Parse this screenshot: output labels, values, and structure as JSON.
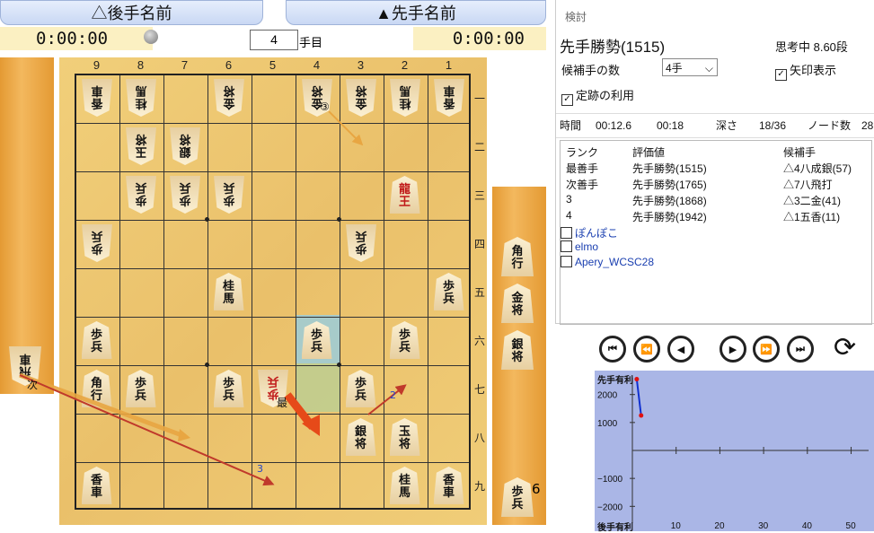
{
  "header": {
    "gote_name": "△後手名前",
    "sente_name": "▲先手名前",
    "gote_time": "0:00:00",
    "sente_time": "0:00:00",
    "move_number": "4",
    "move_unit": "手目"
  },
  "board": {
    "col_labels": [
      "9",
      "8",
      "7",
      "6",
      "5",
      "4",
      "3",
      "2",
      "1"
    ],
    "row_labels": [
      "一",
      "二",
      "三",
      "四",
      "五",
      "六",
      "七",
      "八",
      "九"
    ],
    "pieces": [
      {
        "c": 0,
        "r": 0,
        "t": [
          "香",
          "車"
        ],
        "g": true
      },
      {
        "c": 1,
        "r": 0,
        "t": [
          "桂",
          "馬"
        ],
        "g": true
      },
      {
        "c": 3,
        "r": 0,
        "t": [
          "金",
          "将"
        ],
        "g": true
      },
      {
        "c": 5,
        "r": 0,
        "t": [
          "金",
          "将"
        ],
        "g": true
      },
      {
        "c": 6,
        "r": 0,
        "t": [
          "金",
          "将"
        ],
        "g": true
      },
      {
        "c": 7,
        "r": 0,
        "t": [
          "桂",
          "馬"
        ],
        "g": true
      },
      {
        "c": 8,
        "r": 0,
        "t": [
          "香",
          "車"
        ],
        "g": true
      },
      {
        "c": 1,
        "r": 1,
        "t": [
          "玉",
          "将"
        ],
        "g": true
      },
      {
        "c": 2,
        "r": 1,
        "t": [
          "銀",
          "将"
        ],
        "g": true
      },
      {
        "c": 1,
        "r": 2,
        "t": [
          "歩",
          "兵"
        ],
        "g": true
      },
      {
        "c": 2,
        "r": 2,
        "t": [
          "歩",
          "兵"
        ],
        "g": true
      },
      {
        "c": 3,
        "r": 2,
        "t": [
          "歩",
          "兵"
        ],
        "g": true
      },
      {
        "c": 7,
        "r": 2,
        "t": [
          "龍",
          "王"
        ],
        "g": false,
        "red": true
      },
      {
        "c": 0,
        "r": 3,
        "t": [
          "歩",
          "兵"
        ],
        "g": true
      },
      {
        "c": 6,
        "r": 3,
        "t": [
          "歩",
          "兵"
        ],
        "g": true
      },
      {
        "c": 3,
        "r": 4,
        "t": [
          "桂",
          "馬"
        ],
        "g": false
      },
      {
        "c": 8,
        "r": 4,
        "t": [
          "歩",
          "兵"
        ],
        "g": false
      },
      {
        "c": 0,
        "r": 5,
        "t": [
          "歩",
          "兵"
        ],
        "g": false
      },
      {
        "c": 5,
        "r": 5,
        "t": [
          "歩",
          "兵"
        ],
        "g": false
      },
      {
        "c": 7,
        "r": 5,
        "t": [
          "歩",
          "兵"
        ],
        "g": false
      },
      {
        "c": 0,
        "r": 6,
        "t": [
          "角",
          "行"
        ],
        "g": false
      },
      {
        "c": 1,
        "r": 6,
        "t": [
          "歩",
          "兵"
        ],
        "g": false
      },
      {
        "c": 3,
        "r": 6,
        "t": [
          "歩",
          "兵"
        ],
        "g": false
      },
      {
        "c": 4,
        "r": 6,
        "t": [
          "歩",
          "兵"
        ],
        "g": true,
        "red": true
      },
      {
        "c": 6,
        "r": 6,
        "t": [
          "歩",
          "兵"
        ],
        "g": false
      },
      {
        "c": 6,
        "r": 7,
        "t": [
          "銀",
          "将"
        ],
        "g": false
      },
      {
        "c": 7,
        "r": 7,
        "t": [
          "玉",
          "将"
        ],
        "g": false
      },
      {
        "c": 0,
        "r": 8,
        "t": [
          "香",
          "車"
        ],
        "g": false
      },
      {
        "c": 7,
        "r": 8,
        "t": [
          "桂",
          "馬"
        ],
        "g": false
      },
      {
        "c": 8,
        "r": 8,
        "t": [
          "香",
          "車"
        ],
        "g": false
      }
    ],
    "arrow_labels": {
      "best": "最",
      "next": "次",
      "third": "3",
      "second": "2",
      "circle3": "③"
    }
  },
  "gote_hand": [
    {
      "t": [
        "飛",
        "車"
      ]
    }
  ],
  "sente_hand": [
    {
      "t": [
        "角",
        "行"
      ]
    },
    {
      "t": [
        "金",
        "将"
      ]
    },
    {
      "t": [
        "銀",
        "将"
      ]
    },
    {
      "t": [
        "歩",
        "兵"
      ],
      "count": "6"
    }
  ],
  "panel": {
    "title": "検討",
    "status": "先手勝勢(1515)",
    "thinking": "思考中 8.60段",
    "candidates_label": "候補手の数",
    "candidates_value": "4手",
    "arrow_display_label": "矢印表示",
    "joseki_label": "定跡の利用",
    "stats": {
      "time_label": "時間",
      "time_value": "00:12.6",
      "time2": "00:18",
      "depth_label": "深さ",
      "depth_value": "18/36",
      "nodes_label": "ノード数",
      "nodes_value": "28"
    },
    "columns": [
      "ランク",
      "評価値",
      "候補手"
    ],
    "rows": [
      {
        "rank": "最善手",
        "eval": "先手勝勢(1515)",
        "move": "△4八成銀(57)"
      },
      {
        "rank": "次善手",
        "eval": "先手勝勢(1765)",
        "move": "△7八飛打"
      },
      {
        "rank": "3",
        "eval": "先手勝勢(1868)",
        "move": "△3二金(41)"
      },
      {
        "rank": "4",
        "eval": "先手勝勢(1942)",
        "move": "△1五香(11)"
      }
    ],
    "engines": [
      "ぽんぽこ",
      "elmo",
      "Apery_WCSC28"
    ]
  },
  "nav": {
    "first": "⏮",
    "prev_fast": "⏪",
    "prev": "◀",
    "next": "▶",
    "next_fast": "⏩",
    "last": "⏭",
    "flip": "⟳"
  },
  "chart_data": {
    "type": "line",
    "title": "",
    "top_label": "先手有利",
    "bottom_label": "後手有利",
    "yticks": [
      "2000",
      "1000",
      "−1000",
      "−2000"
    ],
    "xticks": [
      "10",
      "20",
      "30",
      "40",
      "50"
    ],
    "ylim": [
      -2600,
      2600
    ],
    "xlim": [
      0,
      54
    ],
    "series": [
      {
        "values": [
          [
            1,
            2550
          ],
          [
            2,
            1250
          ]
        ]
      }
    ]
  },
  "colors": {
    "arrow_best": "#e64a19",
    "arrow_next": "#e8a642",
    "arrow_line": "#c0392b",
    "graph_bg": "#aab6e6"
  }
}
